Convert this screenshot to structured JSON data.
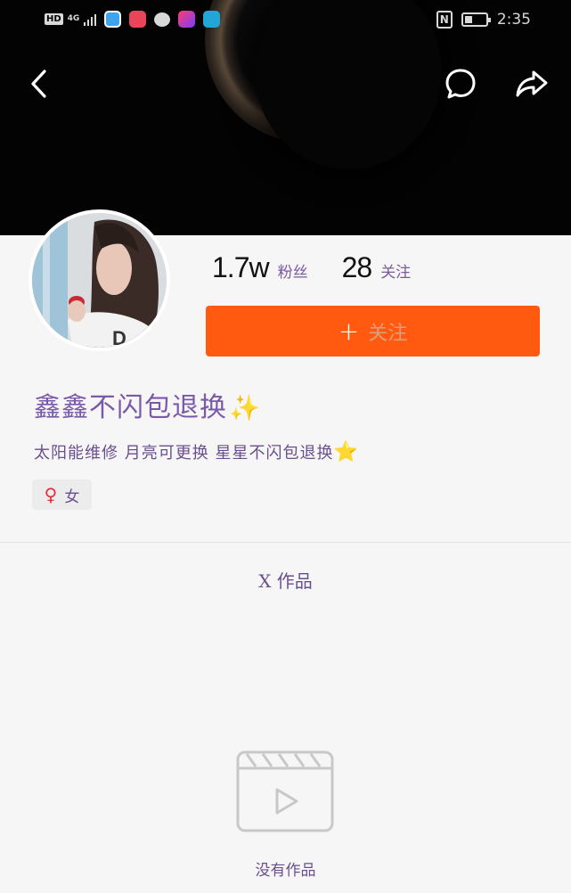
{
  "status_bar": {
    "hd": "HD",
    "network": "4G",
    "nfc": "N",
    "battery_level": 0.35,
    "time": "2:35",
    "app_icons": [
      "app-icon-blue",
      "app-icon-red",
      "chat-icon",
      "video-icon",
      "browser-icon"
    ]
  },
  "nav": {
    "back_icon": "chevron-left-icon",
    "comment_icon": "chat-bubble-icon",
    "share_icon": "share-arrow-icon"
  },
  "profile": {
    "followers_count": "1.7w",
    "followers_label": "粉丝",
    "following_count": "28",
    "following_label": "关注",
    "follow_button_label": "关注",
    "username": "鑫鑫不闪包退换",
    "username_emoji": "✨",
    "bio": "太阳能维修  月亮可更换  星星不闪包退换",
    "bio_emoji": "⭐",
    "gender_icon": "♀",
    "gender_text": "女"
  },
  "works": {
    "tab_label": "X 作品",
    "empty_text": "没有作品",
    "empty_icon": "video-clapper-icon"
  },
  "colors": {
    "accent": "#ff5a10",
    "header_bg": "#030303",
    "page_bg": "#f7f6f7",
    "text_purple": "#6a4f8e"
  }
}
